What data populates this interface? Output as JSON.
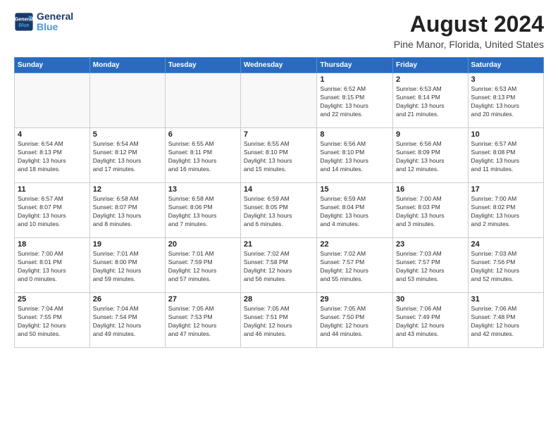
{
  "logo": {
    "line1": "General",
    "line2": "Blue"
  },
  "title": "August 2024",
  "subtitle": "Pine Manor, Florida, United States",
  "days_of_week": [
    "Sunday",
    "Monday",
    "Tuesday",
    "Wednesday",
    "Thursday",
    "Friday",
    "Saturday"
  ],
  "weeks": [
    [
      {
        "day": "",
        "info": ""
      },
      {
        "day": "",
        "info": ""
      },
      {
        "day": "",
        "info": ""
      },
      {
        "day": "",
        "info": ""
      },
      {
        "day": "1",
        "info": "Sunrise: 6:52 AM\nSunset: 8:15 PM\nDaylight: 13 hours\nand 22 minutes."
      },
      {
        "day": "2",
        "info": "Sunrise: 6:53 AM\nSunset: 8:14 PM\nDaylight: 13 hours\nand 21 minutes."
      },
      {
        "day": "3",
        "info": "Sunrise: 6:53 AM\nSunset: 8:13 PM\nDaylight: 13 hours\nand 20 minutes."
      }
    ],
    [
      {
        "day": "4",
        "info": "Sunrise: 6:54 AM\nSunset: 8:13 PM\nDaylight: 13 hours\nand 18 minutes."
      },
      {
        "day": "5",
        "info": "Sunrise: 6:54 AM\nSunset: 8:12 PM\nDaylight: 13 hours\nand 17 minutes."
      },
      {
        "day": "6",
        "info": "Sunrise: 6:55 AM\nSunset: 8:11 PM\nDaylight: 13 hours\nand 16 minutes."
      },
      {
        "day": "7",
        "info": "Sunrise: 6:55 AM\nSunset: 8:10 PM\nDaylight: 13 hours\nand 15 minutes."
      },
      {
        "day": "8",
        "info": "Sunrise: 6:56 AM\nSunset: 8:10 PM\nDaylight: 13 hours\nand 14 minutes."
      },
      {
        "day": "9",
        "info": "Sunrise: 6:56 AM\nSunset: 8:09 PM\nDaylight: 13 hours\nand 12 minutes."
      },
      {
        "day": "10",
        "info": "Sunrise: 6:57 AM\nSunset: 8:08 PM\nDaylight: 13 hours\nand 11 minutes."
      }
    ],
    [
      {
        "day": "11",
        "info": "Sunrise: 6:57 AM\nSunset: 8:07 PM\nDaylight: 13 hours\nand 10 minutes."
      },
      {
        "day": "12",
        "info": "Sunrise: 6:58 AM\nSunset: 8:07 PM\nDaylight: 13 hours\nand 8 minutes."
      },
      {
        "day": "13",
        "info": "Sunrise: 6:58 AM\nSunset: 8:06 PM\nDaylight: 13 hours\nand 7 minutes."
      },
      {
        "day": "14",
        "info": "Sunrise: 6:59 AM\nSunset: 8:05 PM\nDaylight: 13 hours\nand 6 minutes."
      },
      {
        "day": "15",
        "info": "Sunrise: 6:59 AM\nSunset: 8:04 PM\nDaylight: 13 hours\nand 4 minutes."
      },
      {
        "day": "16",
        "info": "Sunrise: 7:00 AM\nSunset: 8:03 PM\nDaylight: 13 hours\nand 3 minutes."
      },
      {
        "day": "17",
        "info": "Sunrise: 7:00 AM\nSunset: 8:02 PM\nDaylight: 13 hours\nand 2 minutes."
      }
    ],
    [
      {
        "day": "18",
        "info": "Sunrise: 7:00 AM\nSunset: 8:01 PM\nDaylight: 13 hours\nand 0 minutes."
      },
      {
        "day": "19",
        "info": "Sunrise: 7:01 AM\nSunset: 8:00 PM\nDaylight: 12 hours\nand 59 minutes."
      },
      {
        "day": "20",
        "info": "Sunrise: 7:01 AM\nSunset: 7:59 PM\nDaylight: 12 hours\nand 57 minutes."
      },
      {
        "day": "21",
        "info": "Sunrise: 7:02 AM\nSunset: 7:58 PM\nDaylight: 12 hours\nand 56 minutes."
      },
      {
        "day": "22",
        "info": "Sunrise: 7:02 AM\nSunset: 7:57 PM\nDaylight: 12 hours\nand 55 minutes."
      },
      {
        "day": "23",
        "info": "Sunrise: 7:03 AM\nSunset: 7:57 PM\nDaylight: 12 hours\nand 53 minutes."
      },
      {
        "day": "24",
        "info": "Sunrise: 7:03 AM\nSunset: 7:56 PM\nDaylight: 12 hours\nand 52 minutes."
      }
    ],
    [
      {
        "day": "25",
        "info": "Sunrise: 7:04 AM\nSunset: 7:55 PM\nDaylight: 12 hours\nand 50 minutes."
      },
      {
        "day": "26",
        "info": "Sunrise: 7:04 AM\nSunset: 7:54 PM\nDaylight: 12 hours\nand 49 minutes."
      },
      {
        "day": "27",
        "info": "Sunrise: 7:05 AM\nSunset: 7:53 PM\nDaylight: 12 hours\nand 47 minutes."
      },
      {
        "day": "28",
        "info": "Sunrise: 7:05 AM\nSunset: 7:51 PM\nDaylight: 12 hours\nand 46 minutes."
      },
      {
        "day": "29",
        "info": "Sunrise: 7:05 AM\nSunset: 7:50 PM\nDaylight: 12 hours\nand 44 minutes."
      },
      {
        "day": "30",
        "info": "Sunrise: 7:06 AM\nSunset: 7:49 PM\nDaylight: 12 hours\nand 43 minutes."
      },
      {
        "day": "31",
        "info": "Sunrise: 7:06 AM\nSunset: 7:48 PM\nDaylight: 12 hours\nand 42 minutes."
      }
    ]
  ]
}
